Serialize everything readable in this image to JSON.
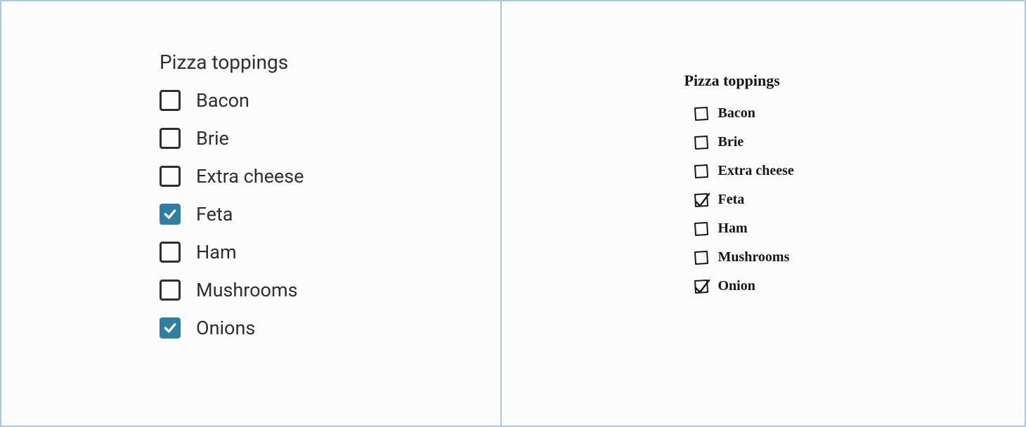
{
  "left_panel": {
    "title": "Pizza toppings",
    "options": [
      {
        "label": "Bacon",
        "checked": false
      },
      {
        "label": "Brie",
        "checked": false
      },
      {
        "label": "Extra cheese",
        "checked": false
      },
      {
        "label": "Feta",
        "checked": true
      },
      {
        "label": "Ham",
        "checked": false
      },
      {
        "label": "Mushrooms",
        "checked": false
      },
      {
        "label": "Onions",
        "checked": true
      }
    ],
    "colors": {
      "accent": "#2f7ea3",
      "text": "#2f2f2f"
    }
  },
  "right_panel": {
    "title": "Pizza toppings",
    "options": [
      {
        "label": "Bacon",
        "checked": false
      },
      {
        "label": "Brie",
        "checked": false
      },
      {
        "label": "Extra cheese",
        "checked": false
      },
      {
        "label": "Feta",
        "checked": true
      },
      {
        "label": "Ham",
        "checked": false
      },
      {
        "label": "Mushrooms",
        "checked": false
      },
      {
        "label": "Onion",
        "checked": true
      }
    ],
    "colors": {
      "text": "#161616"
    }
  }
}
